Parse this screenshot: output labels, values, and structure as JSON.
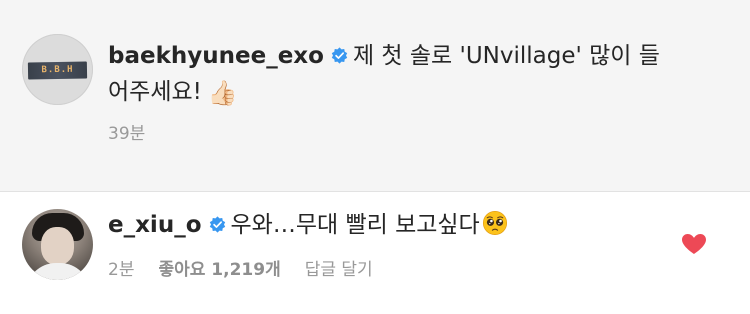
{
  "caption": {
    "username": "baekhyunee_exo",
    "avatar_text": "B.B.H",
    "text_line1": "제 첫 솔로 'UNvillage' 많이 들",
    "text_line2": "어주세요!",
    "emoji": "👍🏻",
    "time": "39분"
  },
  "comment": {
    "username": "e_xiu_o",
    "text": "우와…무대 빨리 보고싶다",
    "emoji_name": "pleading-face",
    "time": "2분",
    "likes": "좋아요 1,219개",
    "reply_label": "답글 달기",
    "liked": true
  },
  "colors": {
    "verified": "#3897f0",
    "heart": "#ed4956",
    "meta": "#999999",
    "caption_bg": "#f5f5f5"
  }
}
